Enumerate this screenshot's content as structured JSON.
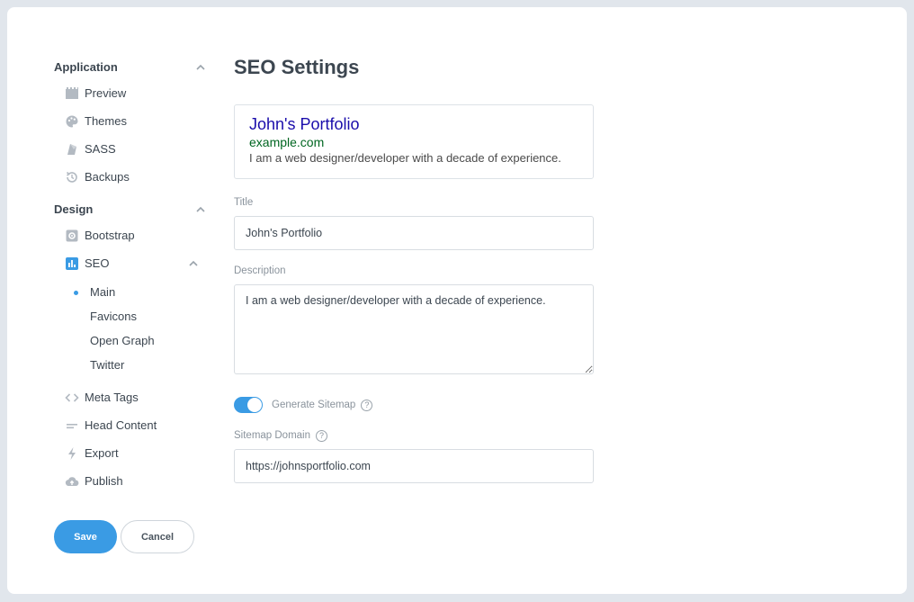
{
  "sidebar": {
    "application": {
      "label": "Application",
      "items": [
        {
          "label": "Preview",
          "icon": "film-icon"
        },
        {
          "label": "Themes",
          "icon": "palette-icon"
        },
        {
          "label": "SASS",
          "icon": "sass-icon"
        },
        {
          "label": "Backups",
          "icon": "history-icon"
        }
      ]
    },
    "design": {
      "label": "Design",
      "items": [
        {
          "label": "Bootstrap",
          "icon": "gear-box-icon"
        },
        {
          "label": "SEO",
          "icon": "bar-chart-icon"
        }
      ],
      "seo_sub": [
        "Main",
        "Favicons",
        "Open Graph",
        "Twitter"
      ],
      "more": [
        {
          "label": "Meta Tags",
          "icon": "code-icon"
        },
        {
          "label": "Head Content",
          "icon": "lines-icon"
        },
        {
          "label": "Export",
          "icon": "bolt-icon"
        },
        {
          "label": "Publish",
          "icon": "cloud-upload-icon"
        }
      ]
    }
  },
  "buttons": {
    "save": "Save",
    "cancel": "Cancel"
  },
  "main": {
    "title": "SEO Settings",
    "preview": {
      "title": "John's Portfolio",
      "url": "example.com",
      "description": "I am a web designer/developer with a decade of experience."
    },
    "title_field": {
      "label": "Title",
      "value": "John's Portfolio"
    },
    "description_field": {
      "label": "Description",
      "value": "I am a web designer/developer with a decade of experience."
    },
    "sitemap_toggle": {
      "label": "Generate Sitemap",
      "on": true
    },
    "sitemap_domain": {
      "label": "Sitemap Domain",
      "value": "https://johnsportfolio.com"
    }
  },
  "colors": {
    "accent": "#3a9be4",
    "link_title": "#1a0dab",
    "link_url": "#006621"
  }
}
